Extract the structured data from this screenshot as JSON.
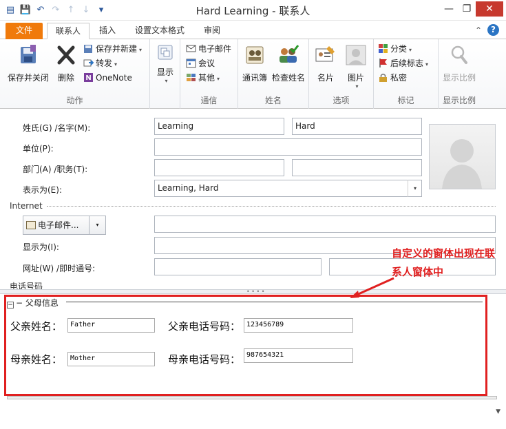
{
  "window": {
    "title": "Hard Learning - 联系人",
    "minimize": "—",
    "maximize": "❐",
    "close": "✕"
  },
  "tabs": [
    {
      "label": "文件"
    },
    {
      "label": "联系人"
    },
    {
      "label": "插入"
    },
    {
      "label": "设置文本格式"
    },
    {
      "label": "审阅"
    }
  ],
  "ribbon": {
    "actions": {
      "label": "动作",
      "save_close": "保存并关闭",
      "delete": "删除",
      "save_new": "保存并新建",
      "forward": "转发",
      "onenote": "OneNote"
    },
    "show": {
      "label": "显示"
    },
    "communicate": {
      "label": "通信",
      "email": "电子邮件",
      "meeting": "会议",
      "more": "其他"
    },
    "names": {
      "label": "姓名",
      "address_book": "通讯簿",
      "check_names": "检查姓名"
    },
    "options": {
      "label": "选项",
      "business_card": "名片",
      "picture": "图片"
    },
    "tags": {
      "label": "标记",
      "categorize": "分类",
      "follow_up": "后续标志",
      "private": "私密"
    },
    "zoom": {
      "label": "显示比例",
      "zoom_btn": "显示比例"
    }
  },
  "form": {
    "name_label": "姓氏(G)  /名字(M):",
    "last_name": "Learning",
    "first_name": "Hard",
    "company_label": "单位(P):",
    "company": "",
    "dept_label": "部门(A)  /职务(T):",
    "department": "",
    "job_title": "",
    "file_as_label": "表示为(E):",
    "file_as": "Learning, Hard",
    "internet_label": "Internet",
    "email_button": "电子邮件...",
    "email": "",
    "display_as_label": "显示为(I):",
    "display_as": "",
    "web_label": "网址(W)  /即时通号:",
    "web": "",
    "im": "",
    "phone_label": "电话号码"
  },
  "custom_region": {
    "group_title": "父母信息",
    "father_name_label": "父亲姓名：",
    "father_name": "Father",
    "father_phone_label": "父亲电话号码：",
    "father_phone": "123456789",
    "mother_name_label": "母亲姓名：",
    "mother_name": "Mother",
    "mother_phone_label": "母亲电话号码：",
    "mother_phone": "987654321"
  },
  "annotation": {
    "line1": "自定义的窗体出现在联",
    "line2": "系人窗体中"
  },
  "colors": {
    "accent_file_tab": "#f07a0b",
    "annotation_red": "#e02020",
    "close_button": "#c7392e"
  }
}
